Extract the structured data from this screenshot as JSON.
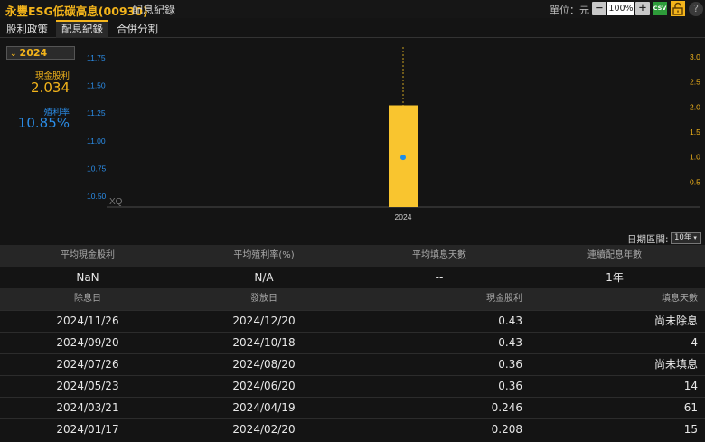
{
  "header": {
    "title": "永豐ESG低碳高息(00930)",
    "subtitle": "配息紀錄",
    "unit_label": "單位：元",
    "zoom_minus": "−",
    "zoom_value": "100%",
    "zoom_plus": "+",
    "csv_label": "CSV",
    "help_label": "?"
  },
  "tabs": [
    {
      "label": "股利政策",
      "active": false
    },
    {
      "label": "配息紀錄",
      "active": true
    },
    {
      "label": "合併分割",
      "active": false
    }
  ],
  "left_panel": {
    "year": "2024",
    "cash_dividend_label": "現金股利",
    "cash_dividend_value": "2.034",
    "yield_label": "殖利率",
    "yield_value": "10.85%"
  },
  "colors": {
    "accent": "#f3b41b",
    "blue": "#2b8de8",
    "background": "#141414"
  },
  "chart_data": {
    "type": "bar",
    "watermark": "XQ",
    "categories": [
      "2024"
    ],
    "series": [
      {
        "axis": "right",
        "values": [
          2.034
        ]
      }
    ],
    "points": [
      {
        "axis": "left",
        "x": "2024",
        "y": 10.85
      }
    ],
    "y_left": {
      "ticks": [
        "11.75",
        "11.50",
        "11.25",
        "11.00",
        "10.75",
        "10.50"
      ],
      "ylim": [
        10.4,
        11.85
      ]
    },
    "y_right": {
      "ticks": [
        "3.0",
        "2.5",
        "2.0",
        "1.5",
        "1.0",
        "0.5"
      ],
      "ylim": [
        0,
        3.2
      ]
    },
    "legend": "none",
    "grid": false
  },
  "range": {
    "label": "日期區間:",
    "value": "10年"
  },
  "summary": {
    "headers": [
      "平均現金股利",
      "平均殖利率(%)",
      "平均填息天數",
      "連續配息年數"
    ],
    "values": [
      "NaN",
      "N/A",
      "--",
      "1年"
    ]
  },
  "records": {
    "headers": [
      "除息日",
      "發放日",
      "現金股利",
      "填息天數"
    ],
    "rows": [
      [
        "2024/11/26",
        "2024/12/20",
        "0.43",
        "尚未除息"
      ],
      [
        "2024/09/20",
        "2024/10/18",
        "0.43",
        "4"
      ],
      [
        "2024/07/26",
        "2024/08/20",
        "0.36",
        "尚未填息"
      ],
      [
        "2024/05/23",
        "2024/06/20",
        "0.36",
        "14"
      ],
      [
        "2024/03/21",
        "2024/04/19",
        "0.246",
        "61"
      ],
      [
        "2024/01/17",
        "2024/02/20",
        "0.208",
        "15"
      ]
    ]
  }
}
